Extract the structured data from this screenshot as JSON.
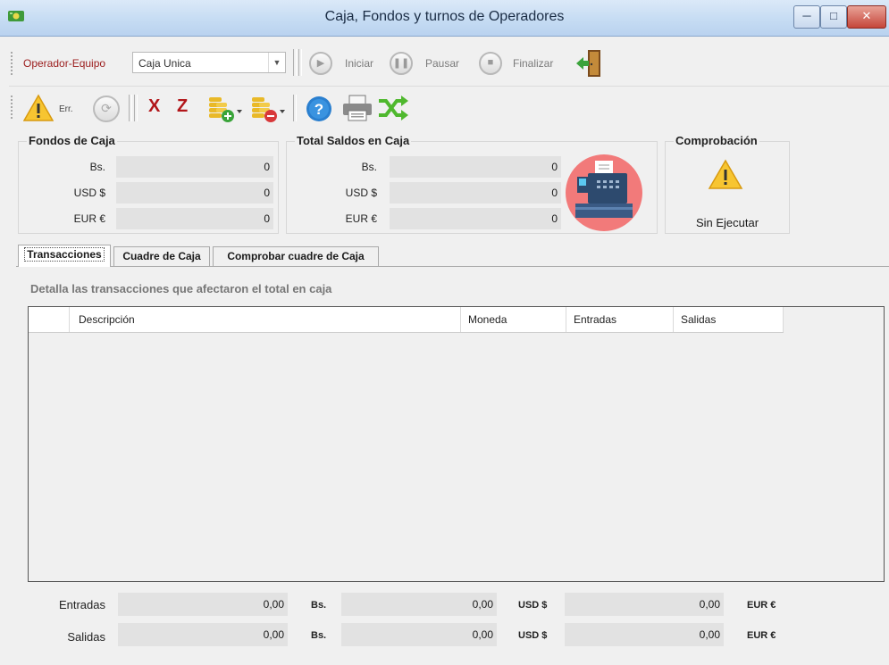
{
  "window": {
    "title": "Caja, Fondos y turnos de Operadores",
    "minimize": "─",
    "maximize": "□",
    "close": "✕"
  },
  "toolbar1": {
    "operador_label": "Operador-Equipo",
    "caja_value": "Caja Unica",
    "iniciar_label": "Iniciar",
    "pausar_label": "Pausar",
    "finalizar_label": "Finalizar"
  },
  "toolbar2": {
    "err_label": "Err.",
    "x_label": "X",
    "z_label": "Z"
  },
  "fondos": {
    "title": "Fondos de Caja",
    "rows": [
      {
        "label": "Bs.",
        "value": "0"
      },
      {
        "label": "USD $",
        "value": "0"
      },
      {
        "label": "EUR €",
        "value": "0"
      }
    ]
  },
  "saldos": {
    "title": "Total Saldos en Caja",
    "rows": [
      {
        "label": "Bs.",
        "value": "0"
      },
      {
        "label": "USD $",
        "value": "0"
      },
      {
        "label": "EUR €",
        "value": "0"
      }
    ]
  },
  "comprobacion": {
    "title": "Comprobación",
    "status": "Sin Ejecutar"
  },
  "tabs": [
    {
      "label": "Transacciones"
    },
    {
      "label": "Cuadre de Caja"
    },
    {
      "label": "Comprobar cuadre de Caja"
    }
  ],
  "transacciones": {
    "description": "Detalla las transacciones que afectaron el total en caja",
    "columns": [
      "Descripción",
      "Moneda",
      "Entradas",
      "Salidas"
    ]
  },
  "totals": {
    "rows": [
      {
        "label": "Entradas",
        "bs": "0,00",
        "usd": "0,00",
        "eur": "0,00"
      },
      {
        "label": "Salidas",
        "bs": "0,00",
        "usd": "0,00",
        "eur": "0,00"
      }
    ],
    "cur_bs": "Bs.",
    "cur_usd": "USD $",
    "cur_eur": "EUR €"
  },
  "colors": {
    "accent_red": "#b2161a",
    "titlebar": "#c6dcf3",
    "register_bg": "#f27a7a"
  }
}
